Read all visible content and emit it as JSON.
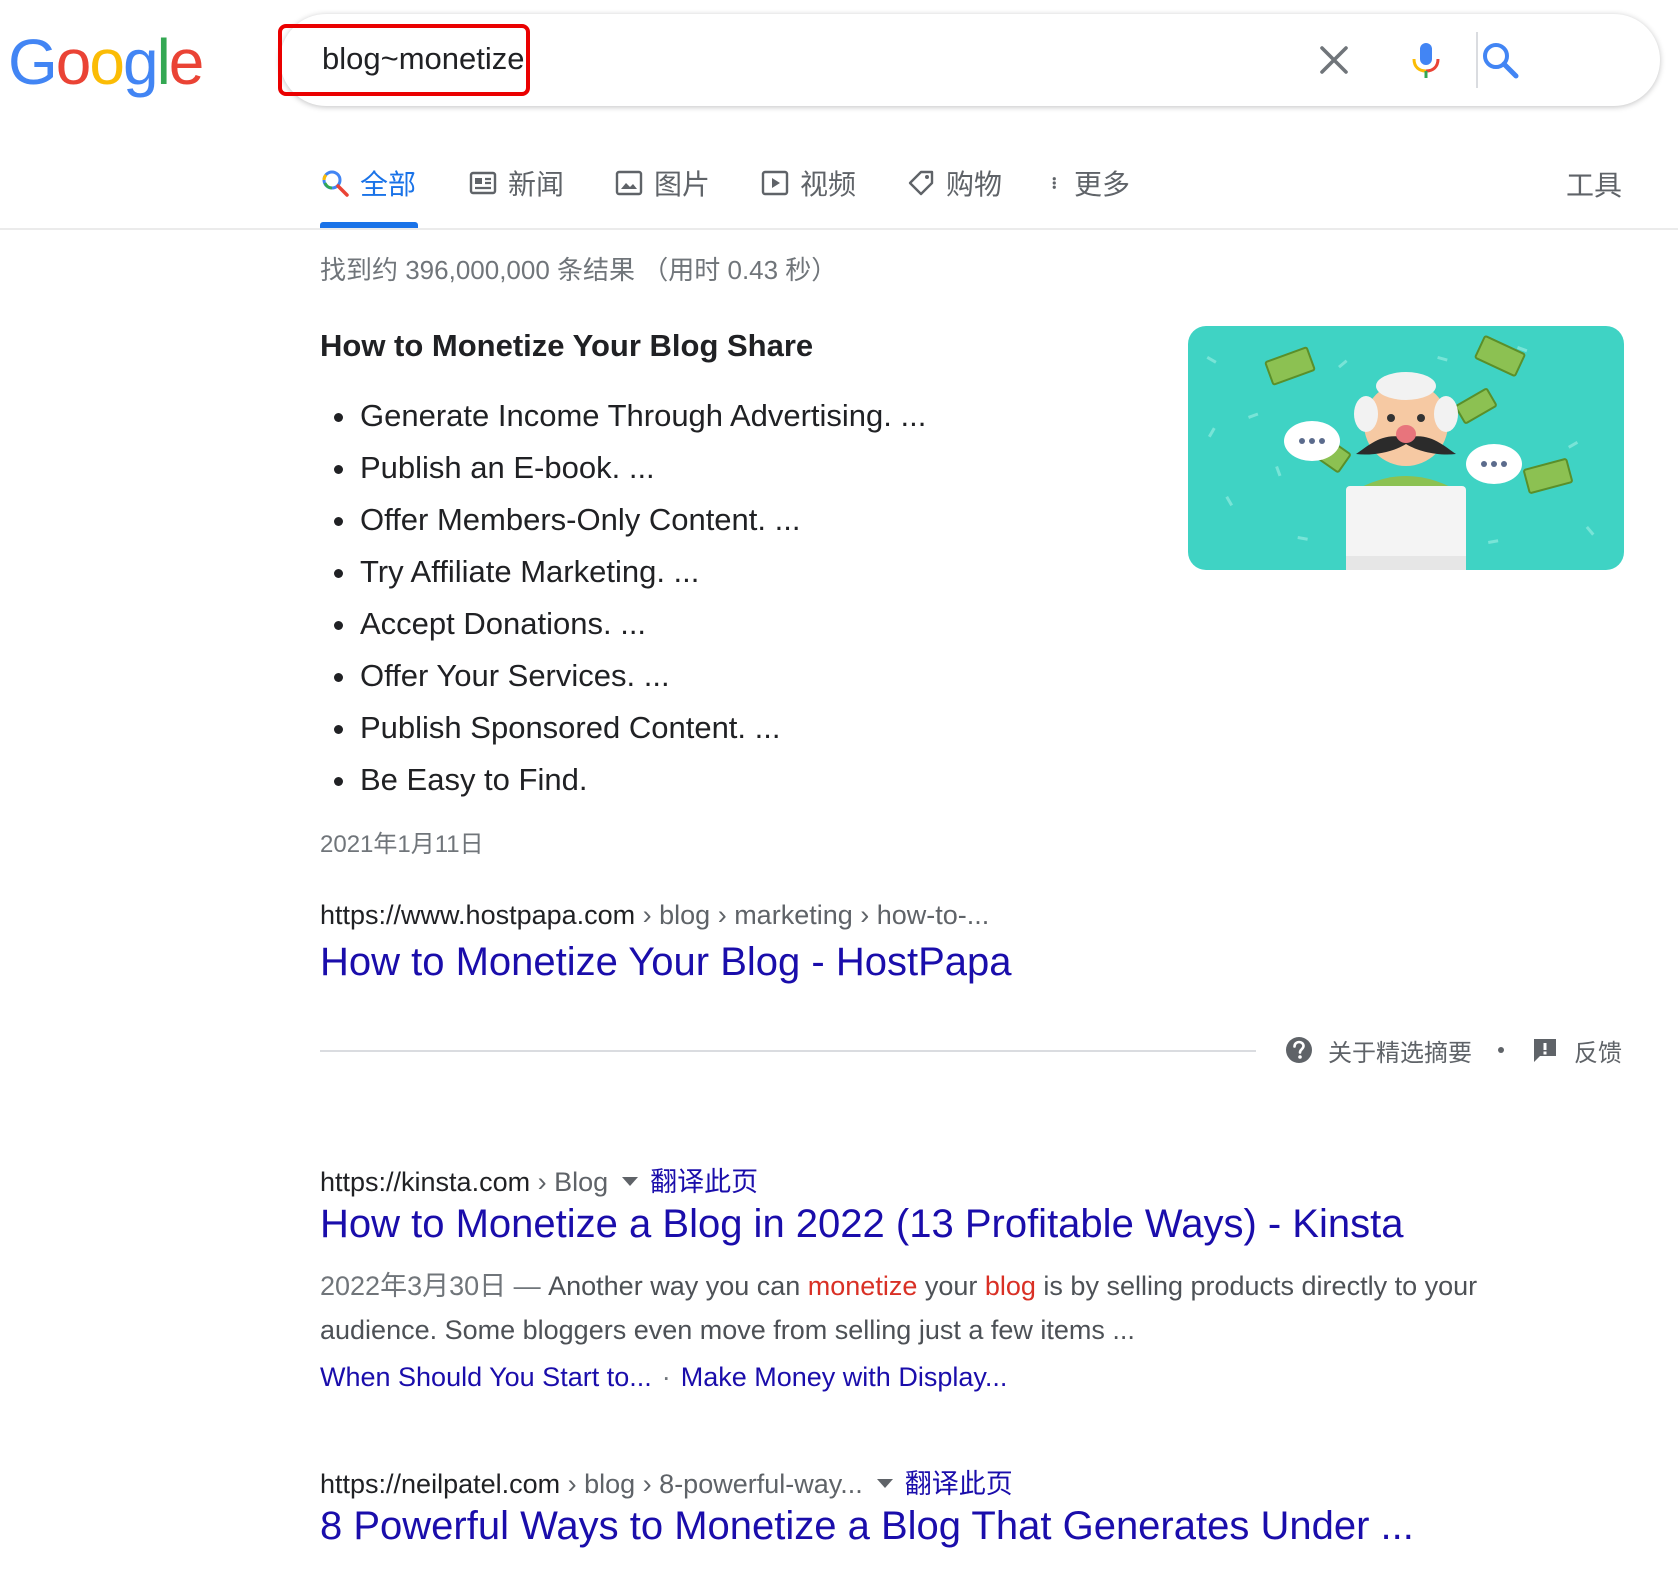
{
  "logo": {
    "letters": [
      "G",
      "o",
      "o",
      "g",
      "l",
      "e"
    ],
    "colors": [
      "#4285f4",
      "#ea4335",
      "#fbbc05",
      "#4285f4",
      "#34a853",
      "#ea4335"
    ]
  },
  "search": {
    "query": "blog~monetize",
    "highlight_color": "#ea0000",
    "icons": [
      "close-icon",
      "microphone-icon",
      "search-icon"
    ]
  },
  "tabs": [
    {
      "label": "全部",
      "icon": "search-icon",
      "active": true
    },
    {
      "label": "新闻",
      "icon": "news-icon",
      "active": false
    },
    {
      "label": "图片",
      "icon": "image-icon",
      "active": false
    },
    {
      "label": "视频",
      "icon": "video-icon",
      "active": false
    },
    {
      "label": "购物",
      "icon": "tag-icon",
      "active": false
    },
    {
      "label": "更多",
      "icon": "more-vertical-icon",
      "active": false
    }
  ],
  "tools_label": "工具",
  "result_stats": "找到约 396,000,000 条结果 （用时 0.43 秒）",
  "featured_snippet": {
    "title": "How to Monetize Your Blog Share",
    "items": [
      "Generate Income Through Advertising. ...",
      "Publish an E-book. ...",
      "Offer Members-Only Content. ...",
      "Try Affiliate Marketing. ...",
      "Accept Donations. ...",
      "Offer Your Services. ...",
      "Publish Sponsored Content. ...",
      "Be Easy to Find."
    ],
    "date": "2021年1月11日",
    "cite_domain": "https://www.hostpapa.com",
    "cite_path": " › blog › marketing › how-to-...",
    "link_title": "How to Monetize Your Blog - HostPapa",
    "footer": {
      "about_label": "关于精选摘要",
      "feedback_label": "反馈"
    }
  },
  "results": [
    {
      "cite_domain": "https://kinsta.com",
      "cite_path": " › Blog",
      "translate": "翻译此页",
      "title": "How to Monetize a Blog in 2022 (13 Profitable Ways) - Kinsta",
      "snippet": {
        "date": "2022年3月30日 — ",
        "part1": "Another way you can ",
        "em1": "monetize",
        "part2": " your ",
        "em2": "blog",
        "part3": " is by selling products directly to your audience. Some bloggers even move from selling just a few items ..."
      },
      "sitelinks": [
        "When Should You Start to...",
        "Make Money with Display..."
      ],
      "sitelink_separator": "·"
    },
    {
      "cite_domain": "https://neilpatel.com",
      "cite_path": " › blog › 8-powerful-way...",
      "translate": "翻译此页",
      "title": "8 Powerful Ways to Monetize a Blog That Generates Under ..."
    }
  ],
  "colors": {
    "link": "#1a0dab",
    "active_tab": "#1a73e8",
    "emphasis": "#d93025"
  }
}
